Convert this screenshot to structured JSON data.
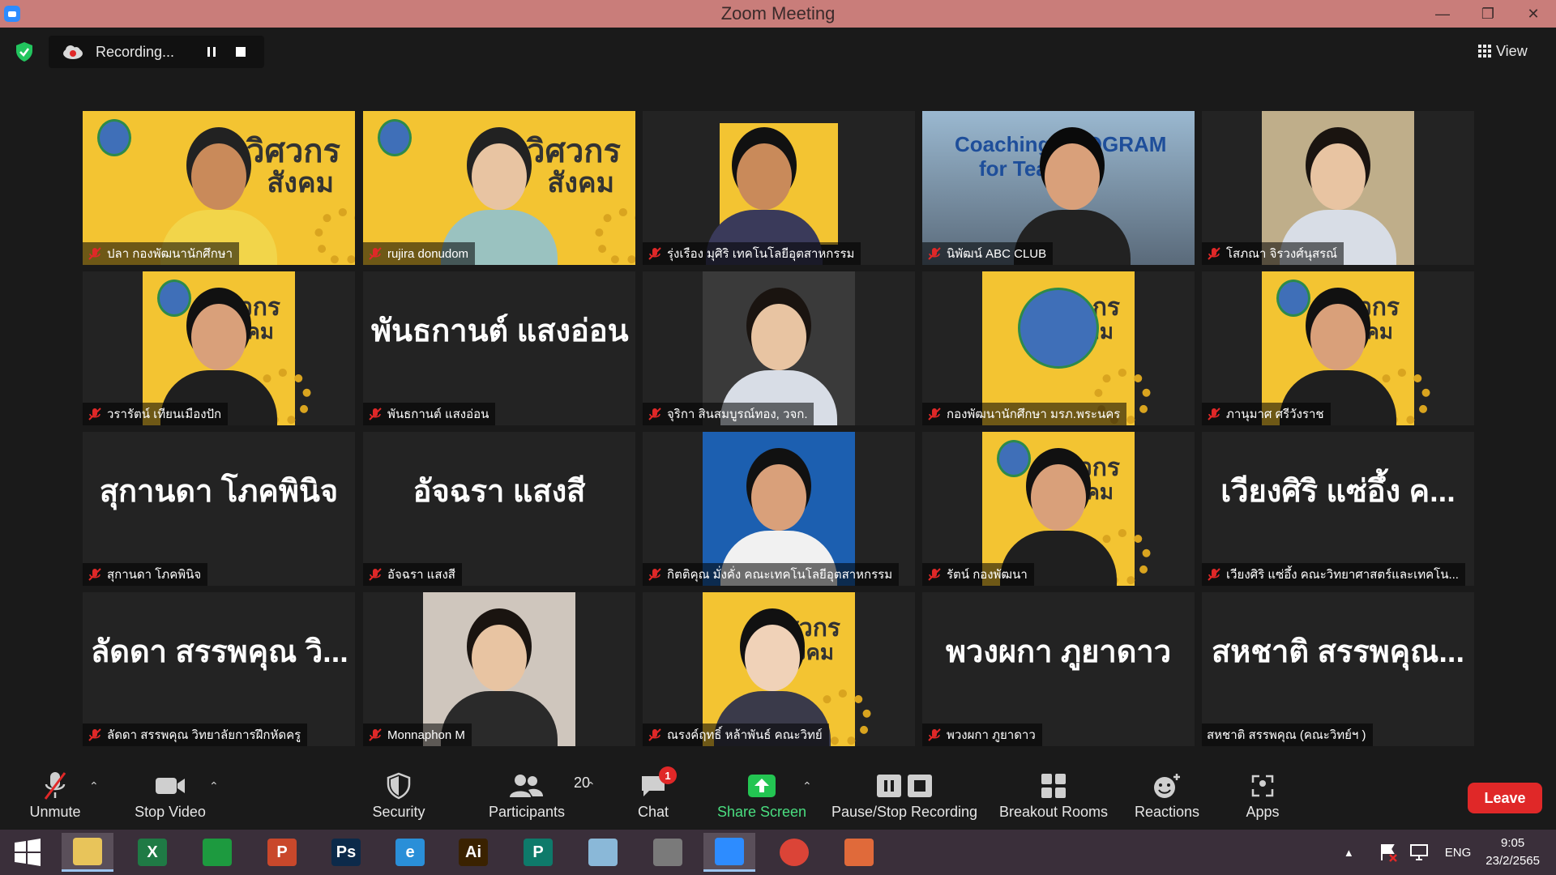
{
  "window": {
    "title": "Zoom Meeting",
    "minimize": "—",
    "restore": "❐",
    "close": "✕"
  },
  "recording": {
    "label": "Recording..."
  },
  "view": {
    "label": "View"
  },
  "tiles": [
    {
      "label": "ปลา กองพัฒนานักศึกษา"
    },
    {
      "label": "rujira donudom"
    },
    {
      "label": "รุ่งเรือง มุศิริ เทคโนโลยีอุตสาหกรรม"
    },
    {
      "label": "นิพัฒน์ ABC CLUB",
      "screen_text_1": "Coaching PROGRAM",
      "screen_text_2": "for Teacher"
    },
    {
      "label": "โสภณา จิรวงศ์นุสรณ์"
    },
    {
      "label": "วรารัตน์ เทียนเมืองปัก"
    },
    {
      "label": "พันธกานต์ แสงอ่อน",
      "bigname": "พันธกานต์ แสงอ่อน"
    },
    {
      "label": "จุริกา สินสมบูรณ์ทอง, วจก."
    },
    {
      "label": "กองพัฒนานักศึกษา มรภ.พระนคร"
    },
    {
      "label": "ภานุมาศ ศรีวังราช"
    },
    {
      "label": "สุกานดา โภคพินิจ",
      "bigname": "สุกานดา โภคพินิจ"
    },
    {
      "label": "อัจฉรา แสงสี",
      "bigname": "อัจฉรา แสงสี"
    },
    {
      "label": "กิตติคุณ มั่งคั่ง คณะเทคโนโลยีอุตสาหกรรม"
    },
    {
      "label": "รัตน์ กองพัฒนา"
    },
    {
      "label": "เวียงศิริ แซ่อึ้ง คณะวิทยาศาสตร์และเทคโน...",
      "bigname": "เวียงศิริ แซ่อึ้ง ค..."
    },
    {
      "label": "ลัดดา สรรพคุณ วิทยาลัยการฝึกหัดครู",
      "bigname": "ลัดดา สรรพคุณ วิ..."
    },
    {
      "label": "Monnaphon M"
    },
    {
      "label": "ณรงค์ฤทธิ์ หล้าพันธ์ คณะวิทย์"
    },
    {
      "label": "พวงผกา ภูยาดาว",
      "bigname": "พวงผกา ภูยาดาว"
    },
    {
      "label": "สหชาติ สรรพคุณ (คณะวิทย์ฯ )",
      "bigname": "สหชาติ สรรพคุณ..."
    }
  ],
  "banner": {
    "title_1": "วิศวกร",
    "title_2": "สังคม"
  },
  "toolbar": {
    "unmute": "Unmute",
    "stop_video": "Stop Video",
    "security": "Security",
    "participants": "Participants",
    "participants_count": "20",
    "chat": "Chat",
    "chat_badge": "1",
    "share_screen": "Share Screen",
    "pause_stop_recording": "Pause/Stop Recording",
    "breakout_rooms": "Breakout Rooms",
    "reactions": "Reactions",
    "apps": "Apps",
    "leave": "Leave"
  },
  "taskbar": {
    "apps": [
      {
        "name": "file-explorer",
        "glyph": "",
        "color": "#e8c45a"
      },
      {
        "name": "excel",
        "glyph": "X",
        "color": "#1f7a45"
      },
      {
        "name": "store",
        "glyph": "",
        "color": "#1d9a3f"
      },
      {
        "name": "powerpoint",
        "glyph": "P",
        "color": "#c9482b"
      },
      {
        "name": "photoshop",
        "glyph": "Ps",
        "color": "#0c2a4a"
      },
      {
        "name": "internet-explorer",
        "glyph": "e",
        "color": "#2a8fd8"
      },
      {
        "name": "illustrator",
        "glyph": "Ai",
        "color": "#3a2200"
      },
      {
        "name": "publisher",
        "glyph": "P",
        "color": "#0e7a6a"
      },
      {
        "name": "notes",
        "glyph": "",
        "color": "#8ab8d8"
      },
      {
        "name": "photoscape",
        "glyph": "",
        "color": "#7a7a7a"
      },
      {
        "name": "zoom",
        "glyph": "",
        "color": "#2d8cff"
      },
      {
        "name": "chrome",
        "glyph": "",
        "color": "#db4437"
      },
      {
        "name": "powerpoint-viewer",
        "glyph": "",
        "color": "#e06a3a"
      }
    ],
    "lang": "ENG",
    "time": "9:05",
    "date": "23/2/2565"
  }
}
